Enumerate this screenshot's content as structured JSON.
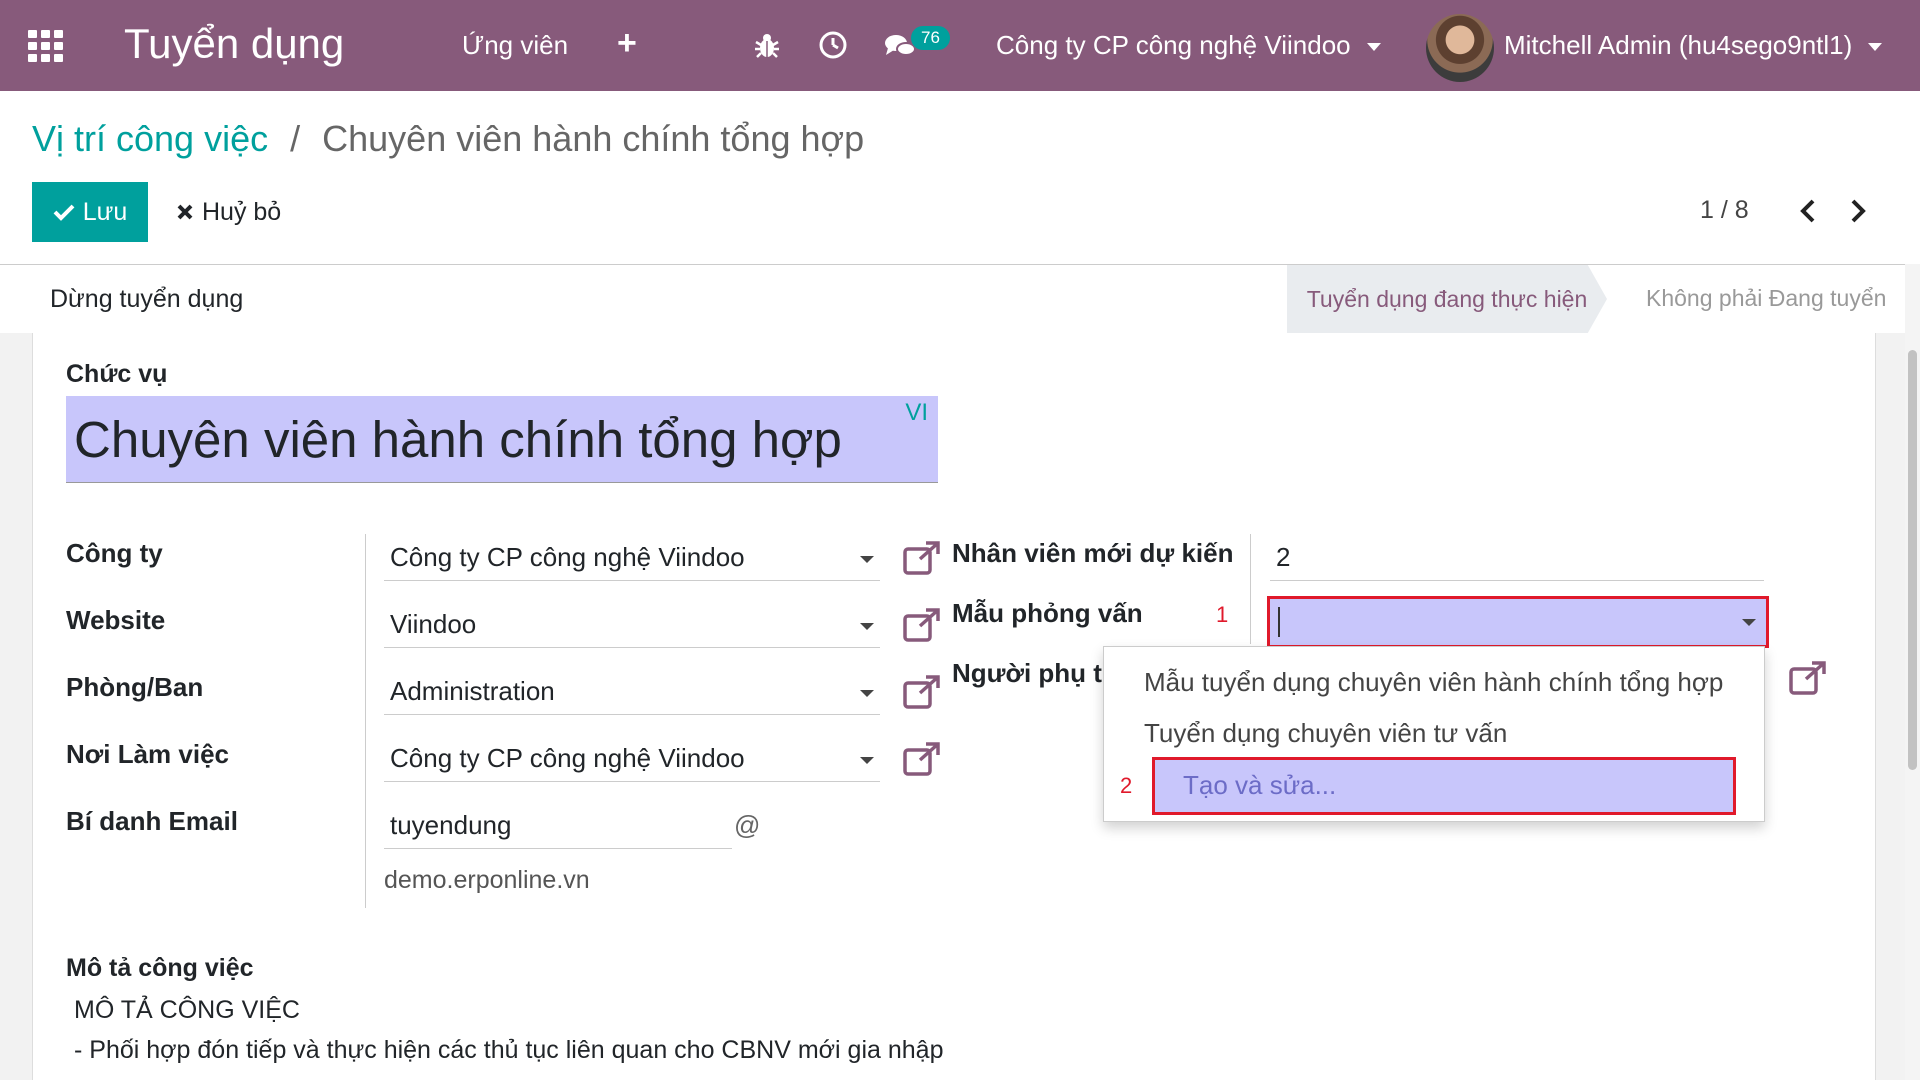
{
  "navbar": {
    "brand": "Tuyển dụng",
    "menu": "Ứng viên",
    "plus": "+",
    "messages_count": "76",
    "company": "Công ty CP công nghệ Viindoo",
    "user": "Mitchell Admin (hu4sego9ntl1)",
    "icons": [
      "apps-icon",
      "plus-icon",
      "bug-icon",
      "clock-icon",
      "chat-icon",
      "caret-down-icon"
    ],
    "color": "#875a7b"
  },
  "breadcrumb": {
    "parent": "Vị trí công việc",
    "separator": "/",
    "current": "Chuyên viên hành chính tổng hợp"
  },
  "actions": {
    "save": "Lưu",
    "discard": "Huỷ bỏ"
  },
  "pager": {
    "value": "1 / 8"
  },
  "statusbar": {
    "stop_button": "Dừng tuyển dụng",
    "stages": [
      "Tuyển dụng đang thực hiện",
      "Không phải Đang tuyển"
    ]
  },
  "form": {
    "title_label": "Chức vụ",
    "title_value": "Chuyên viên hành chính tổng hợp",
    "lang": "VI",
    "fields": {
      "company_label": "Công ty",
      "company_value": "Công ty CP công nghệ Viindoo",
      "website_label": "Website",
      "website_value": "Viindoo",
      "department_label": "Phòng/Ban",
      "department_value": "Administration",
      "workplace_label": "Nơi Làm việc",
      "workplace_value": "Công ty CP công nghệ Viindoo",
      "email_alias_label": "Bí danh Email",
      "email_alias_value": "tuyendung",
      "email_at": "@",
      "email_domain": "demo.erponline.vn",
      "expected_new_label": "Nhân viên mới dự kiến",
      "expected_new_value": "2",
      "interview_template_label": "Mẫu phỏng vấn",
      "responsible_label": "Người phụ tra"
    },
    "dropdown": {
      "options": [
        "Mẫu tuyển dụng chuyên viên hành chính tổng hợp",
        "Tuyển dụng chuyên viên tư vấn"
      ],
      "create_edit": "Tạo và sửa..."
    },
    "markers": [
      "1",
      "2"
    ],
    "description_label": "Mô tả công việc",
    "description_lines": [
      "MÔ TẢ CÔNG VIỆC",
      "- Phối hợp đón tiếp và thực hiện các thủ tục liên quan cho CBNV mới gia nhập"
    ]
  },
  "colors": {
    "accent": "#00a09d",
    "highlight_field": "#c8c6fb",
    "annotation_red": "#e0192b"
  }
}
